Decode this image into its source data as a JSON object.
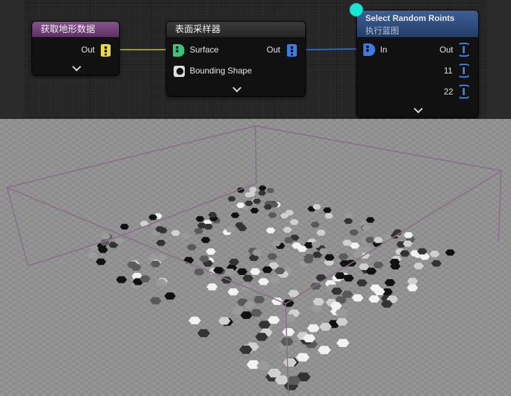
{
  "nodes": {
    "terrain": {
      "title": "获取地形数据",
      "out_label": "Out"
    },
    "surface": {
      "title": "表面采样器",
      "in_label": "Surface",
      "shape_label": "Bounding Shape",
      "out_label": "Out"
    },
    "select": {
      "title": "Select Random Roints",
      "subtitle": "执行蓝图",
      "in_label": "In",
      "out_label": "Out",
      "pin2_label": "11",
      "pin3_label": "22"
    }
  },
  "colors": {
    "terrain_header": "#6b3d73",
    "select_header": "#2d4a7a",
    "yellow_pin": "#e8d84a",
    "green_pin": "#3cc27a",
    "blue_pin": "#3f7be0",
    "bounds_line": "#8a6e87",
    "selection_marker": "#18e7d6"
  },
  "icons": [
    "expand-chevron-icon",
    "point-data-pin-icon",
    "bounding-shape-icon"
  ]
}
